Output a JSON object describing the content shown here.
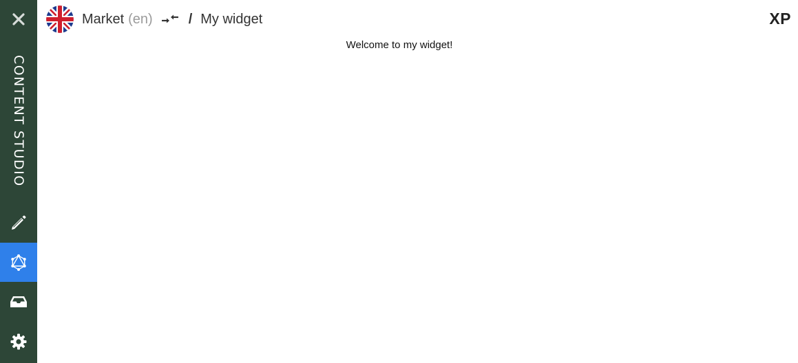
{
  "sidebar": {
    "app_title": "CONTENT STUDIO",
    "background": "#2d4637",
    "active_color": "#2f80ea",
    "close_icon": "close-icon",
    "items": [
      {
        "icon": "pencil-icon",
        "active": false
      },
      {
        "icon": "graphql-icon",
        "active": true
      },
      {
        "icon": "inbox-icon",
        "active": false
      },
      {
        "icon": "gear-icon",
        "active": false
      }
    ]
  },
  "header": {
    "flag_icon": "uk-flag-icon",
    "project_name": "Market",
    "language": "(en)",
    "switch_icon": "switch-project-icon",
    "separator": "/",
    "widget_name": "My widget",
    "logo_text": "XP"
  },
  "main": {
    "welcome_text": "Welcome to my widget!"
  }
}
